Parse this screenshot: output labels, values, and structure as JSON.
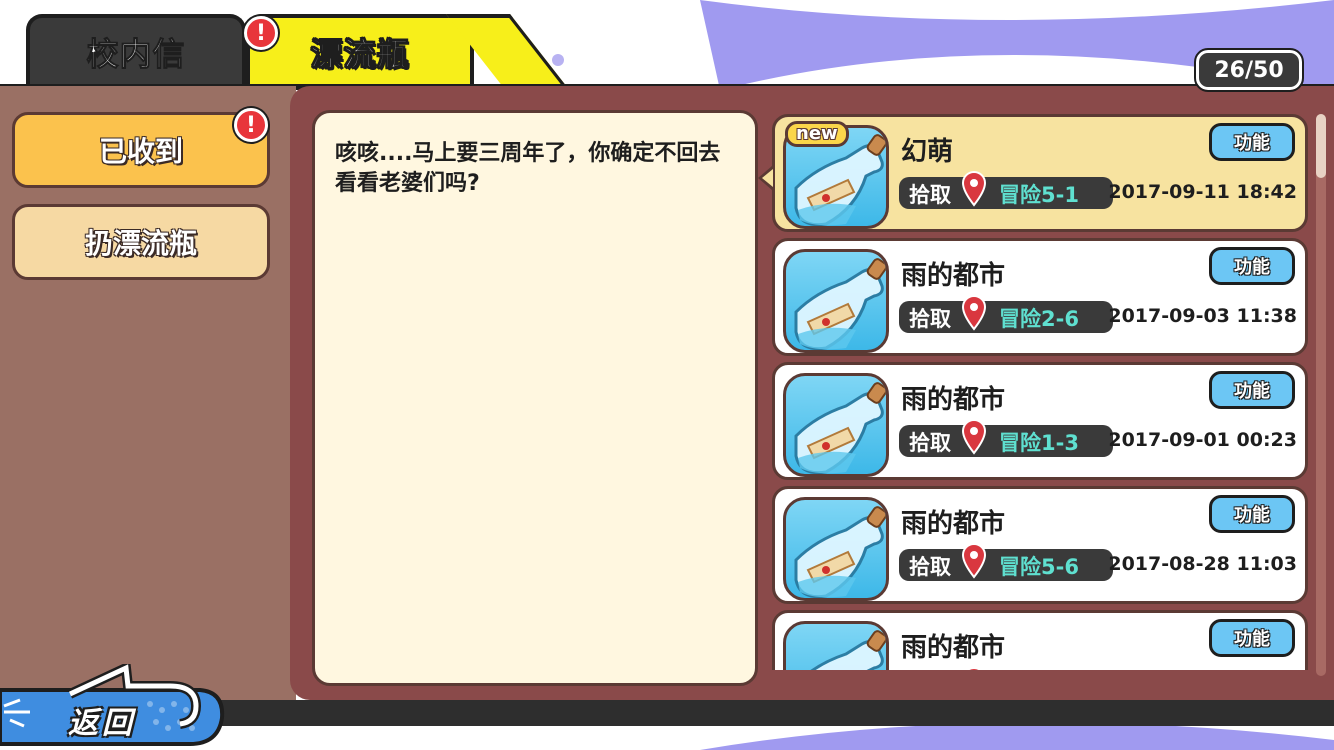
{
  "tabs": [
    {
      "label": "校内信",
      "active": false
    },
    {
      "label": "漂流瓶",
      "active": true,
      "alert": "!"
    }
  ],
  "counter": "26/50",
  "sidebar": {
    "items": [
      {
        "label": "已收到",
        "active": true,
        "alert": "!"
      },
      {
        "label": "扔漂流瓶",
        "active": false
      }
    ]
  },
  "message": "咳咳....马上要三周年了，你确定不回去看看老婆们吗?",
  "bottles": [
    {
      "title": "幻萌",
      "new": "new",
      "pick_label": "拾取",
      "stage": "冒险5-1",
      "date": "2017-09-11 18:42",
      "func": "功能",
      "selected": true
    },
    {
      "title": "雨的都市",
      "pick_label": "拾取",
      "stage": "冒险2-6",
      "date": "2017-09-03 11:38",
      "func": "功能"
    },
    {
      "title": "雨的都市",
      "pick_label": "拾取",
      "stage": "冒险1-3",
      "date": "2017-09-01 00:23",
      "func": "功能"
    },
    {
      "title": "雨的都市",
      "pick_label": "拾取",
      "stage": "冒险5-6",
      "date": "2017-08-28 11:03",
      "func": "功能"
    },
    {
      "title": "雨的都市",
      "pick_label": "",
      "stage": "",
      "date": "",
      "func": "功能"
    }
  ],
  "back_button": "返回",
  "colors": {
    "accent_yellow": "#f7ef1a",
    "panel_brown": "#8a4a4a",
    "button_blue": "#6cc6f4",
    "stage_teal": "#5fe0d0",
    "alert_red": "#e8353b"
  }
}
